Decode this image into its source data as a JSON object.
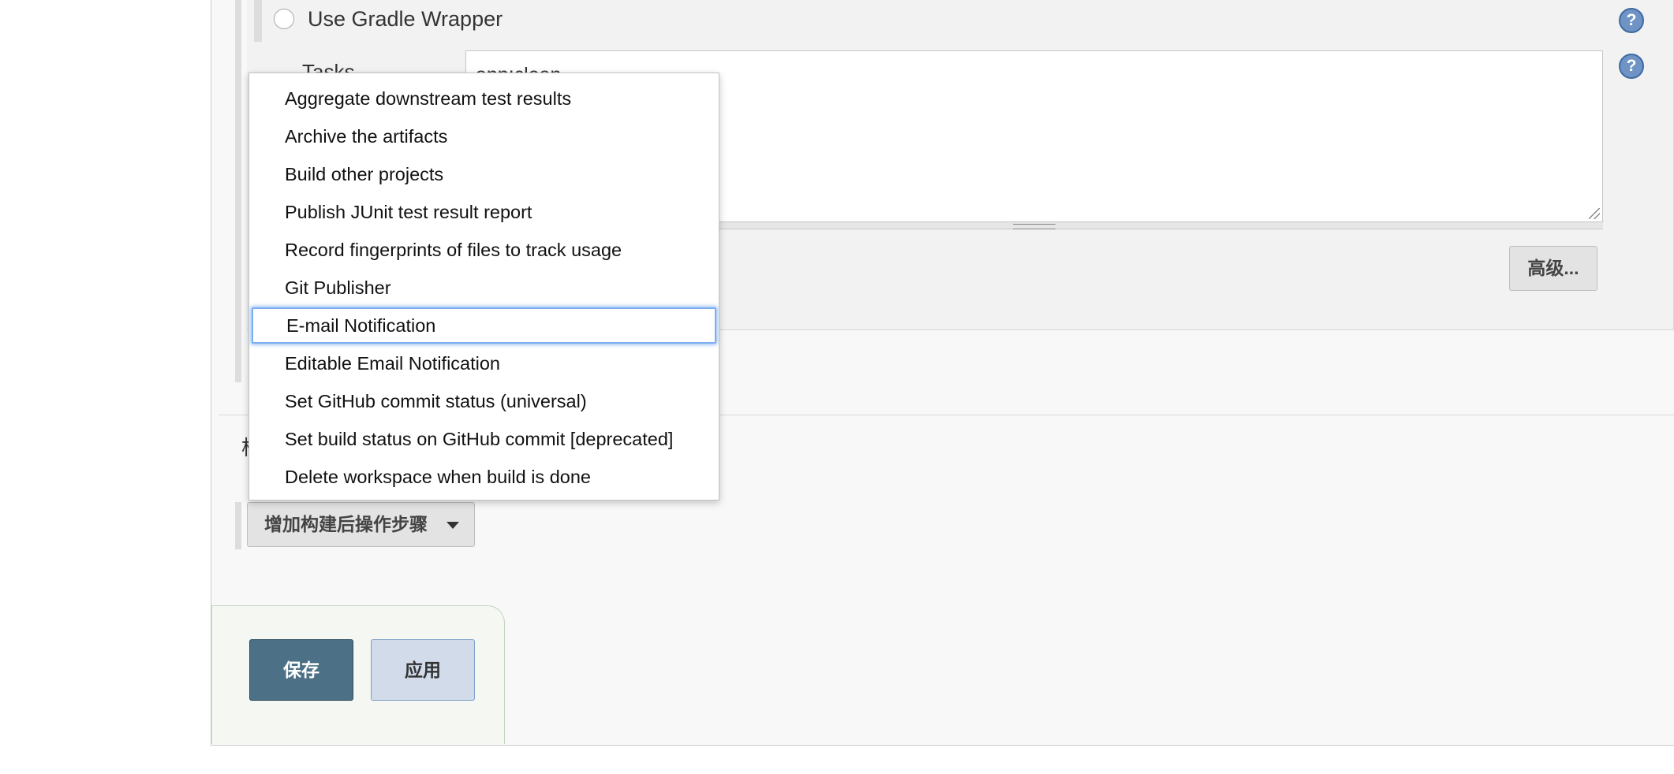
{
  "gradle": {
    "wrapper_option_label": "Use Gradle Wrapper",
    "tasks_label": "Tasks",
    "tasks_value": "app:clean"
  },
  "help_icon_glyph": "?",
  "advanced_button_label": "高级...",
  "section_label_partial": "构",
  "add_post_build_step_label": "增加构建后操作步骤",
  "post_build_menu": {
    "items": [
      {
        "label": "Aggregate downstream test results"
      },
      {
        "label": "Archive the artifacts"
      },
      {
        "label": "Build other projects"
      },
      {
        "label": "Publish JUnit test result report"
      },
      {
        "label": "Record fingerprints of files to track usage"
      },
      {
        "label": "Git Publisher"
      },
      {
        "label": "E-mail Notification",
        "focused": true
      },
      {
        "label": "Editable Email Notification"
      },
      {
        "label": "Set GitHub commit status (universal)"
      },
      {
        "label": "Set build status on GitHub commit [deprecated]"
      },
      {
        "label": "Delete workspace when build is done"
      }
    ]
  },
  "footer": {
    "save_label": "保存",
    "apply_label": "应用"
  },
  "colors": {
    "save_button": "#4c7186",
    "apply_button": "#d1dbe9",
    "focus_ring": "#7aaef0",
    "help_icon": "#6f93c4"
  }
}
